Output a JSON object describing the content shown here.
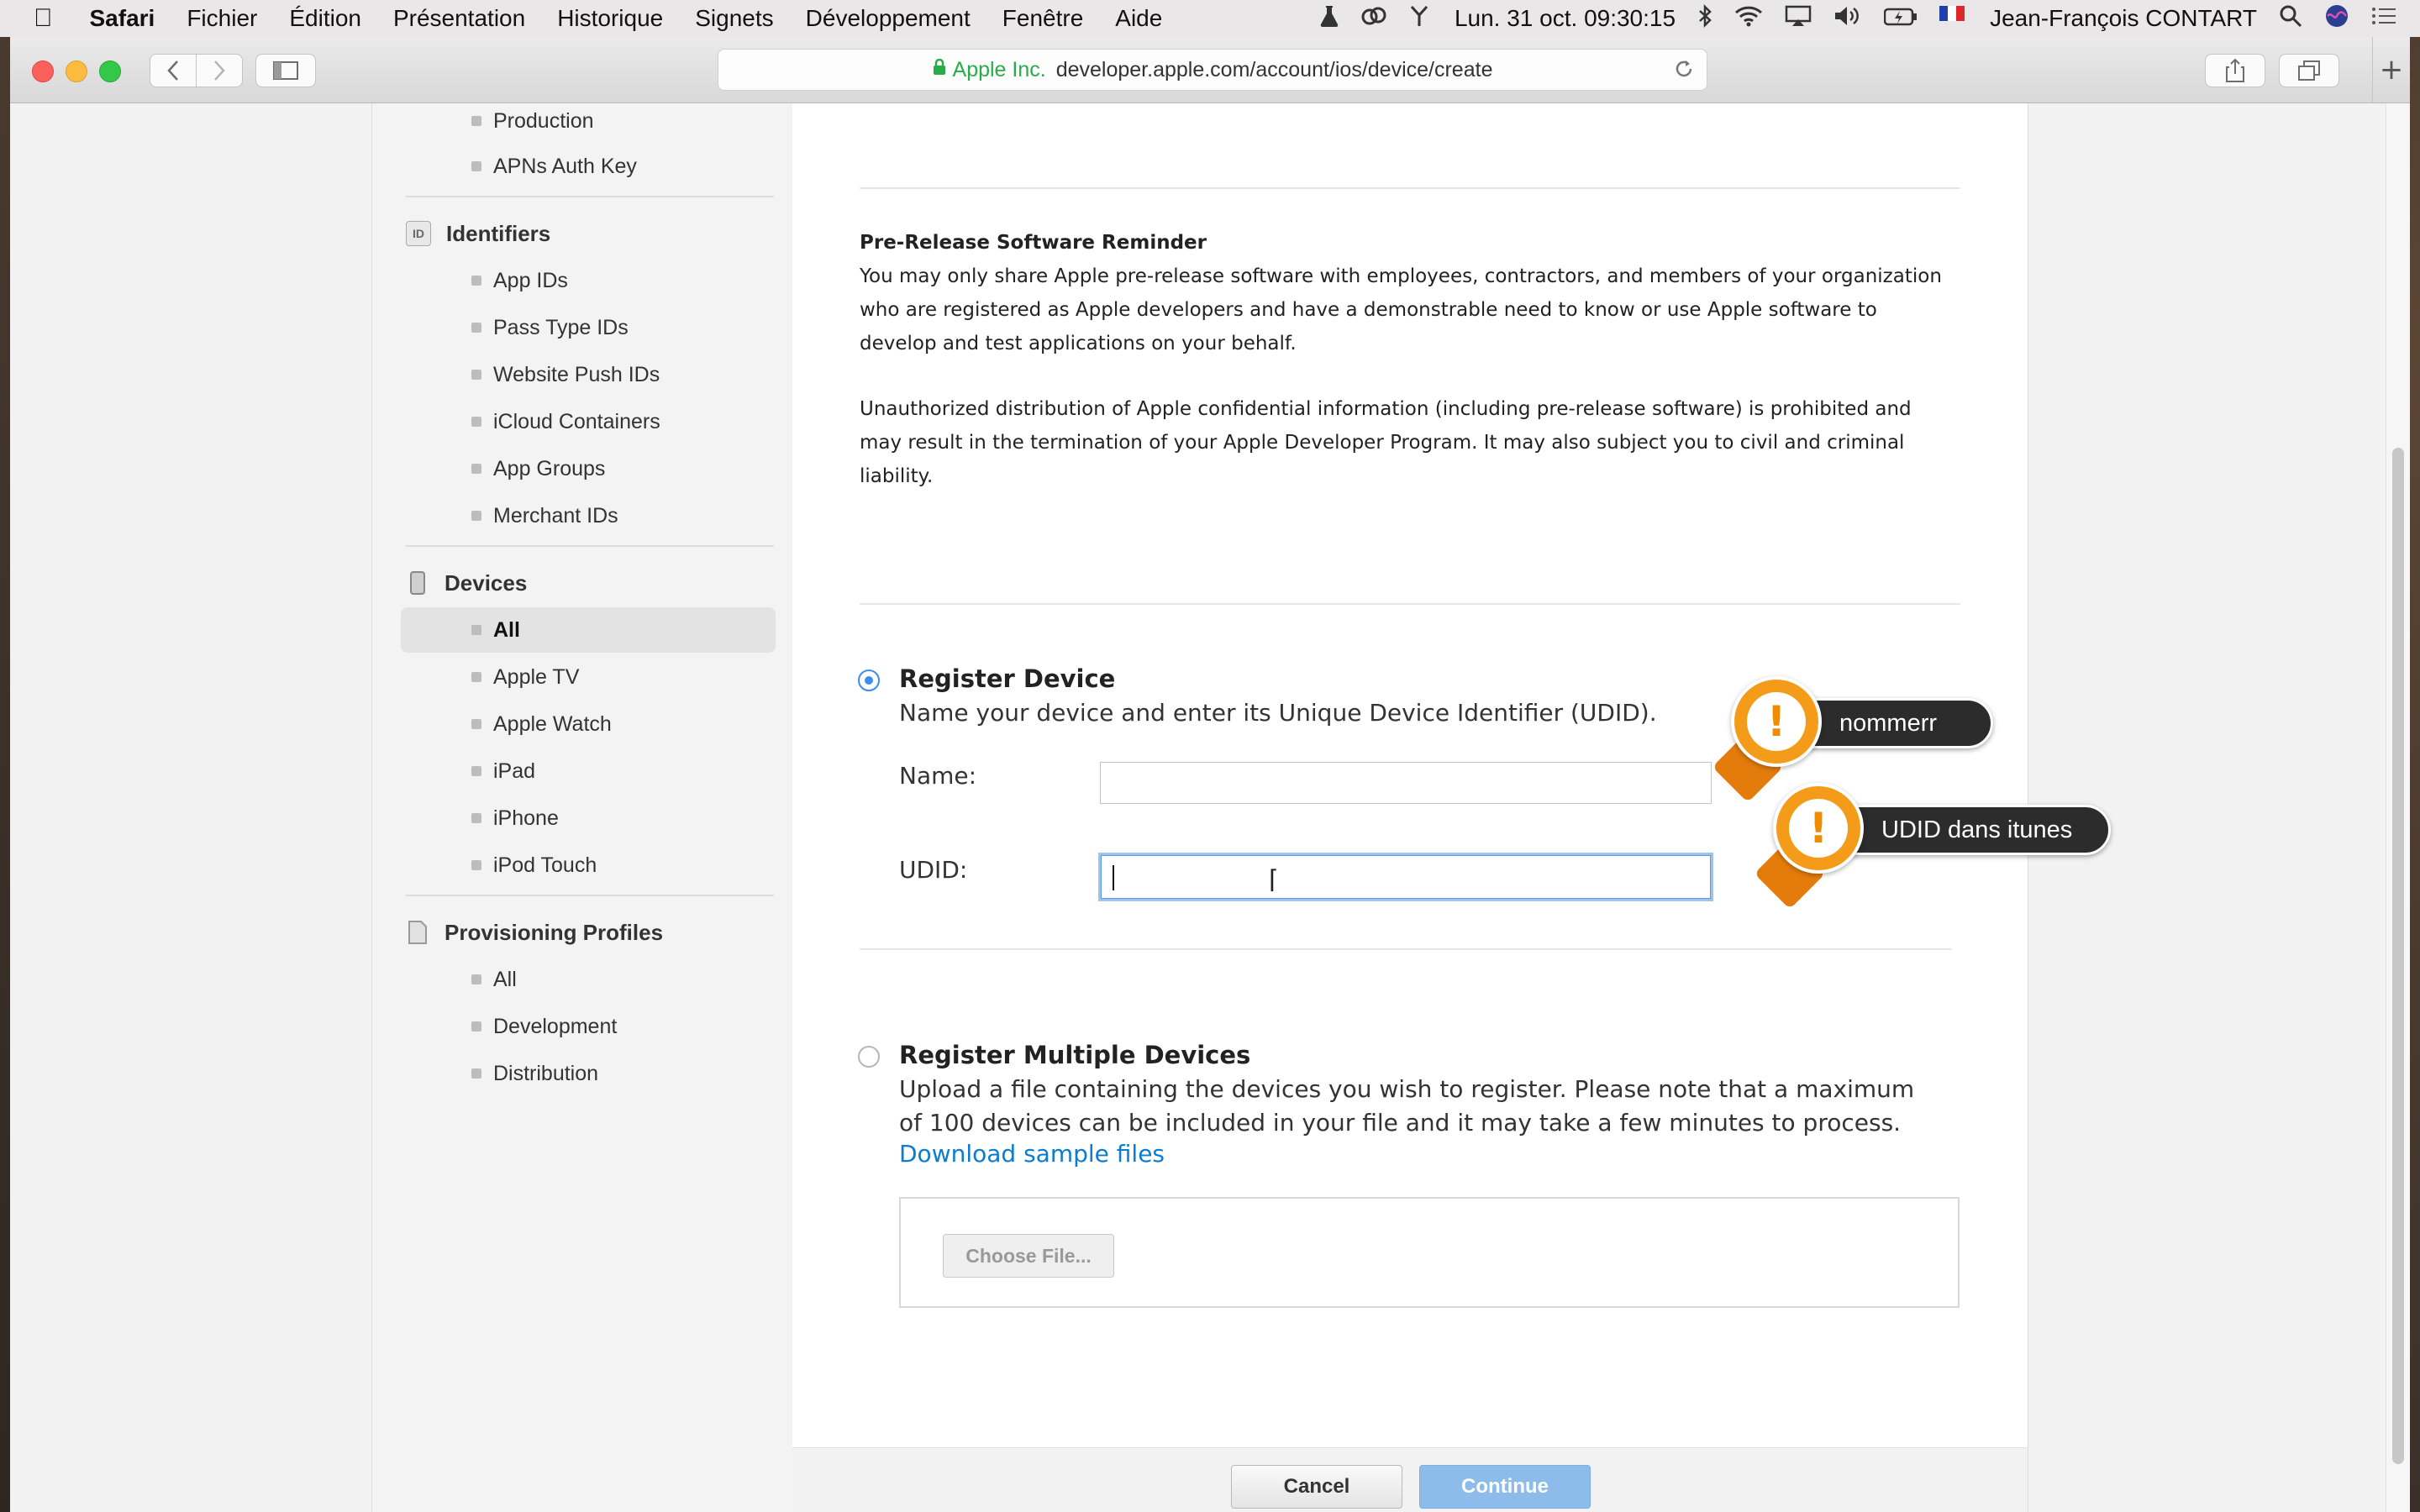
{
  "menubar": {
    "apple_icon": "apple-logo-icon",
    "app_name": "Safari",
    "menus": [
      "Fichier",
      "Édition",
      "Présentation",
      "Historique",
      "Signets",
      "Développement",
      "Fenêtre",
      "Aide"
    ],
    "clock": "Lun. 31 oct.  09:30:15",
    "user": "Jean-François CONTART"
  },
  "browser": {
    "address_company": "Apple Inc.",
    "address_url": "developer.apple.com/account/ios/device/create"
  },
  "sidebar": {
    "top_items": [
      "Production",
      "APNs Auth Key"
    ],
    "identifiers": {
      "heading": "Identifiers",
      "icon_label": "ID",
      "items": [
        "App IDs",
        "Pass Type IDs",
        "Website Push IDs",
        "iCloud Containers",
        "App Groups",
        "Merchant IDs"
      ]
    },
    "devices": {
      "heading": "Devices",
      "items": [
        "All",
        "Apple TV",
        "Apple Watch",
        "iPad",
        "iPhone",
        "iPod Touch"
      ],
      "active": "All"
    },
    "profiles": {
      "heading": "Provisioning Profiles",
      "items": [
        "All",
        "Development",
        "Distribution"
      ]
    }
  },
  "reminder": {
    "title": "Pre-Release Software Reminder",
    "paragraph1": "You may only share Apple pre-release software with employees, contractors, and members of your organization who are registered as Apple developers and have a demonstrable need to know or use Apple software to develop and test applications on your behalf.",
    "paragraph2": "Unauthorized distribution of Apple confidential information (including pre-release software) is prohibited and may result in the termination of your Apple Developer Program. It may also subject you to civil and criminal liability."
  },
  "register_device": {
    "title": "Register Device",
    "description": "Name your device and enter its Unique Device Identifier (UDID).",
    "name_label": "Name:",
    "name_value": "",
    "udid_label": "UDID:",
    "udid_value": "",
    "selected": true
  },
  "register_multiple": {
    "title": "Register Multiple Devices",
    "description": "Upload a file containing the devices you wish to register. Please note that a maximum of 100 devices can be included in your file and it may take a few minutes to process.",
    "link": "Download sample files",
    "choose_file": "Choose File...",
    "selected": false
  },
  "footer": {
    "cancel": "Cancel",
    "continue": "Continue"
  },
  "callouts": {
    "name_hint": "nommerr",
    "udid_hint": "UDID dans itunes",
    "badge_glyph": "!"
  },
  "colors": {
    "accent": "#3c8df3",
    "link": "#0b7ccf",
    "continue_disabled": "#8ebcea",
    "callout_orange": "#f59b1a"
  }
}
